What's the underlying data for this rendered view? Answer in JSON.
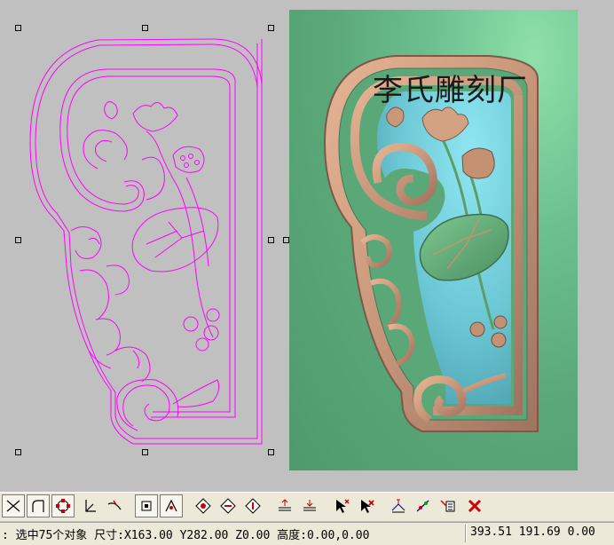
{
  "watermark": "李氏雕刻厂",
  "status": {
    "left": ": 选中75个对象 尺寸:X163.00 Y282.00 Z0.00 高度:0.00,0.00",
    "coords": "393.51 191.69 0.00"
  },
  "colors": {
    "vector_outline": "#ff00ff",
    "canvas_bg": "#c0c0c0",
    "relief_bg": "#5aa778",
    "relief_frame": "#c8967a",
    "relief_inner": "#6fc9d8"
  },
  "toolbar": {
    "buttons": [
      {
        "name": "trim-tool-icon",
        "pressed": true
      },
      {
        "name": "fillet-tool-icon",
        "pressed": true
      },
      {
        "name": "node-edit-icon",
        "pressed": true
      },
      {
        "name": "extend-tool-icon",
        "pressed": false
      },
      {
        "name": "split-curve-icon",
        "pressed": false
      },
      {
        "name": "snap-grid-icon",
        "pressed": true
      },
      {
        "name": "snap-node-icon",
        "pressed": true
      },
      {
        "name": "diamond-tool-1-icon",
        "pressed": false
      },
      {
        "name": "diamond-tool-2-icon",
        "pressed": false
      },
      {
        "name": "diamond-tool-3-icon",
        "pressed": false
      },
      {
        "name": "layer-up-icon",
        "pressed": false
      },
      {
        "name": "layer-down-icon",
        "pressed": false
      },
      {
        "name": "select-add-icon",
        "pressed": false
      },
      {
        "name": "select-remove-icon",
        "pressed": false
      },
      {
        "name": "transform-1-icon",
        "pressed": false
      },
      {
        "name": "transform-2-icon",
        "pressed": false
      },
      {
        "name": "transform-3-icon",
        "pressed": false
      },
      {
        "name": "delete-icon",
        "pressed": false
      }
    ]
  }
}
